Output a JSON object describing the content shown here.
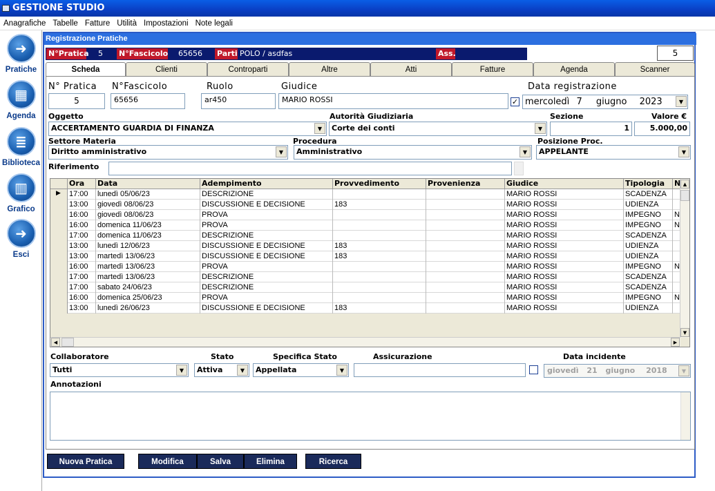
{
  "app": {
    "title": "GESTIONE STUDIO"
  },
  "menu": [
    "Anagrafiche",
    "Tabelle",
    "Fatture",
    "Utilità",
    "Impostazioni",
    "Note legali"
  ],
  "nav": [
    {
      "label": "Pratiche",
      "icon": "exit-icon"
    },
    {
      "label": "Agenda",
      "icon": "calendar-icon"
    },
    {
      "label": "Biblioteca",
      "icon": "books-icon"
    },
    {
      "label": "Grafico",
      "icon": "chart-icon"
    },
    {
      "label": "Esci",
      "icon": "exit-icon"
    }
  ],
  "window": {
    "title": "Registrazione Pratiche"
  },
  "infobar": {
    "pratica_label": "N°Pratica",
    "pratica": "5",
    "fascicolo_label": "N°Fascicolo",
    "fascicolo": "65656",
    "parti_label": "Parti",
    "parti": "POLO / asdfas",
    "ass_label": "Ass."
  },
  "page_number": "5",
  "tabs": [
    "Scheda",
    "Clienti",
    "Controparti",
    "Altre",
    "Atti",
    "Fatture",
    "Agenda",
    "Scanner"
  ],
  "form": {
    "n_pratica_label": "N° Pratica",
    "n_pratica": "5",
    "n_fascicolo_label": "N°Fascicolo",
    "n_fascicolo": "65656",
    "ruolo_label": "Ruolo",
    "ruolo": "ar450",
    "giudice_label": "Giudice",
    "giudice": "MARIO ROSSI",
    "data_reg_label": "Data registrazione",
    "data_reg": {
      "weekday": "mercoledì",
      "day": "7",
      "month": "giugno",
      "year": "2023"
    },
    "oggetto_label": "Oggetto",
    "oggetto": "ACCERTAMENTO GUARDIA DI FINANZA",
    "autorita_label": "Autorità Giudiziaria",
    "autorita": "Corte dei conti",
    "sezione_label": "Sezione",
    "sezione": "1",
    "valore_label": "Valore €",
    "valore": "5.000,00",
    "settore_label": "Settore Materia",
    "settore": "Diritto amministrativo",
    "procedura_label": "Procedura",
    "procedura": "Amministrativo",
    "posizione_label": "Posizione Proc.",
    "posizione": "APPELANTE",
    "riferimento_label": "Riferimento",
    "riferimento": ""
  },
  "grid": {
    "columns": [
      "Ora",
      "Data",
      "Adempimento",
      "Provvedimento",
      "Provenienza",
      "Giudice",
      "Tipologia",
      "N"
    ],
    "rows": [
      [
        "17:00",
        "lunedì 05/06/23",
        "DESCRIZIONE",
        "",
        "",
        "MARIO ROSSI",
        "SCADENZA",
        ""
      ],
      [
        "13:00",
        "giovedì 08/06/23",
        " DISCUSSIONE E DECISIONE",
        "183",
        "",
        "MARIO ROSSI",
        "UDIENZA",
        ""
      ],
      [
        "16:00",
        "giovedì 08/06/23",
        "PROVA",
        "",
        "",
        "MARIO ROSSI",
        "IMPEGNO",
        "N"
      ],
      [
        "16:00",
        "domenica 11/06/23",
        "PROVA",
        "",
        "",
        "MARIO ROSSI",
        "IMPEGNO",
        "N"
      ],
      [
        "17:00",
        "domenica 11/06/23",
        "DESCRIZIONE",
        "",
        "",
        "MARIO ROSSI",
        "SCADENZA",
        ""
      ],
      [
        "13:00",
        "lunedì 12/06/23",
        " DISCUSSIONE E DECISIONE",
        "183",
        "",
        "MARIO ROSSI",
        "UDIENZA",
        ""
      ],
      [
        "13:00",
        "martedì 13/06/23",
        " DISCUSSIONE E DECISIONE",
        "183",
        "",
        "MARIO ROSSI",
        "UDIENZA",
        ""
      ],
      [
        "16:00",
        "martedì 13/06/23",
        "PROVA",
        "",
        "",
        "MARIO ROSSI",
        "IMPEGNO",
        "N"
      ],
      [
        "17:00",
        "martedì 13/06/23",
        "DESCRIZIONE",
        "",
        "",
        "MARIO ROSSI",
        "SCADENZA",
        ""
      ],
      [
        "17:00",
        "sabato 24/06/23",
        "DESCRIZIONE",
        "",
        "",
        "MARIO ROSSI",
        "SCADENZA",
        ""
      ],
      [
        "16:00",
        "domenica 25/06/23",
        "PROVA",
        "",
        "",
        "MARIO ROSSI",
        "IMPEGNO",
        "N"
      ],
      [
        "13:00",
        "lunedì 26/06/23",
        " DISCUSSIONE E DECISIONE",
        "183",
        "",
        "MARIO ROSSI",
        "UDIENZA",
        ""
      ]
    ]
  },
  "bottom": {
    "collaboratore_label": "Collaboratore",
    "collaboratore": "Tutti",
    "stato_label": "Stato",
    "stato": "Attiva",
    "specifica_label": "Specifica Stato",
    "specifica": "Appellata",
    "assicurazione_label": "Assicurazione",
    "assicurazione": "",
    "data_incidente_label": "Data incidente",
    "data_incidente": {
      "weekday": "giovedì",
      "day": "21",
      "month": "giugno",
      "year": "2018"
    },
    "annotazioni_label": "Annotazioni",
    "annotazioni": ""
  },
  "buttons": {
    "nuova": "Nuova Pratica",
    "modifica": "Modifica",
    "salva": "Salva",
    "elimina": "Elimina",
    "ricerca": "Ricerca"
  }
}
